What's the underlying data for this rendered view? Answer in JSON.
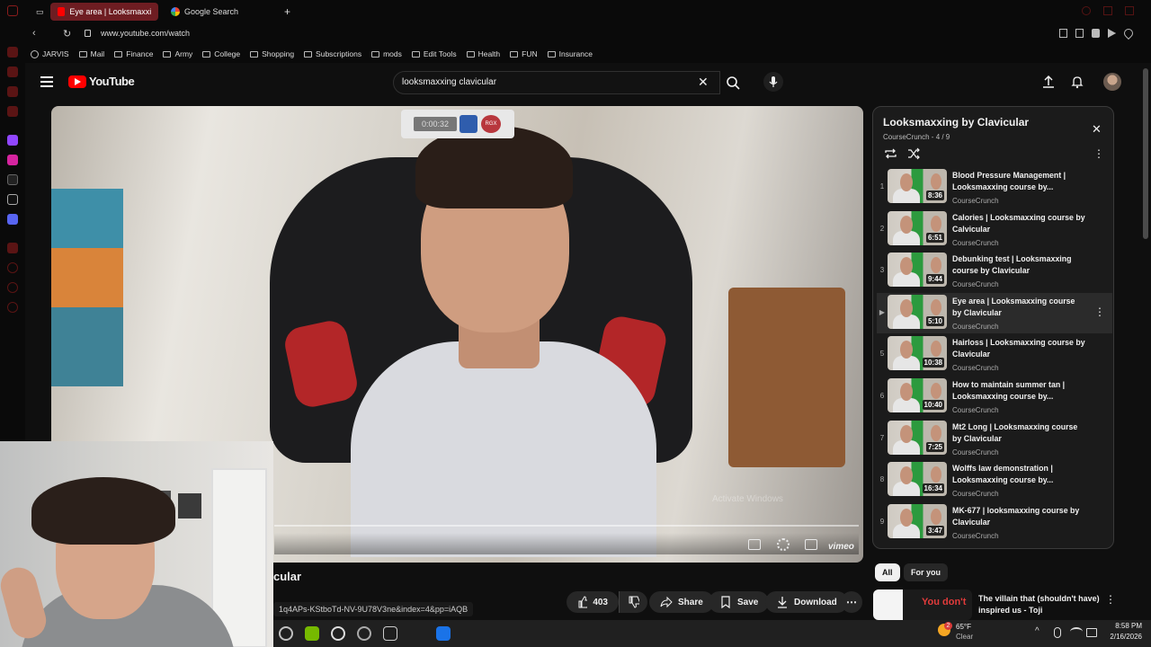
{
  "browser": {
    "tabs": [
      {
        "label": "Eye area | Looksmaxxing c",
        "active": true
      },
      {
        "label": "Google Search",
        "active": false
      }
    ],
    "url": "www.youtube.com/watch",
    "bookmarks": [
      "JARVIS",
      "Mail",
      "Finance",
      "Army",
      "College",
      "Shopping",
      "Subscriptions",
      "mods",
      "Edit Tools",
      "Health",
      "FUN",
      "Insurance"
    ]
  },
  "youtube": {
    "logo_text": "YouTube",
    "search_query": "looksmaxxing clavicular",
    "player": {
      "ext_label": "RGX",
      "timestamp": "0:00:32",
      "watermark": "vimeo",
      "activate_windows": "Activate Windows"
    },
    "video_title_partial": "cular",
    "share_url_partial": "1q4APs-KStboTd-NV-9U78V3ne&index=4&pp=iAQB",
    "actions": {
      "likes": "403",
      "share": "Share",
      "save": "Save",
      "download": "Download"
    },
    "playlist": {
      "title": "Looksmaxxing by Clavicular",
      "subtitle": "CourseCrunch - 4 / 9",
      "items": [
        {
          "index": "1",
          "title": "Blood Pressure Management | Looksmaxxing course by...",
          "channel": "CourseCrunch",
          "duration": "8:36",
          "current": false
        },
        {
          "index": "2",
          "title": "Calories | Looksmaxxing course by Calvicular",
          "channel": "CourseCrunch",
          "duration": "6:51",
          "current": false
        },
        {
          "index": "3",
          "title": "Debunking test | Looksmaxxing course by Clavicular",
          "channel": "CourseCrunch",
          "duration": "9:44",
          "current": false
        },
        {
          "index": "▶",
          "title": "Eye area | Looksmaxxing course by Clavicular",
          "channel": "CourseCrunch",
          "duration": "5:10",
          "current": true
        },
        {
          "index": "5",
          "title": "Hairloss | Looksmaxxing course by Clavicular",
          "channel": "CourseCrunch",
          "duration": "10:38",
          "current": false
        },
        {
          "index": "6",
          "title": "How to maintain summer tan | Looksmaxxing course by...",
          "channel": "CourseCrunch",
          "duration": "10:40",
          "current": false
        },
        {
          "index": "7",
          "title": "Mt2 Long | Looksmaxxing course by Clavicular",
          "channel": "CourseCrunch",
          "duration": "7:25",
          "current": false
        },
        {
          "index": "8",
          "title": "Wolffs law demonstration | Looksmaxxing course by...",
          "channel": "CourseCrunch",
          "duration": "16:34",
          "current": false
        },
        {
          "index": "9",
          "title": "MK-677 | looksmaxxing course by Clavicular",
          "channel": "CourseCrunch",
          "duration": "3:47",
          "current": false
        }
      ]
    },
    "chips": [
      "All",
      "For you"
    ],
    "recommendation": {
      "title": "The villain that (shouldn't have) inspired us - Toji",
      "thumb_text": "You don't"
    }
  },
  "taskbar": {
    "weather_temp": "65°F",
    "weather_cond": "Clear",
    "weather_badge": "2",
    "time": "8:58 PM",
    "date": "2/16/2026"
  },
  "colors": {
    "yt_red": "#ff0000",
    "bg": "#0f0f0f",
    "tab_active": "#6e1d22"
  }
}
